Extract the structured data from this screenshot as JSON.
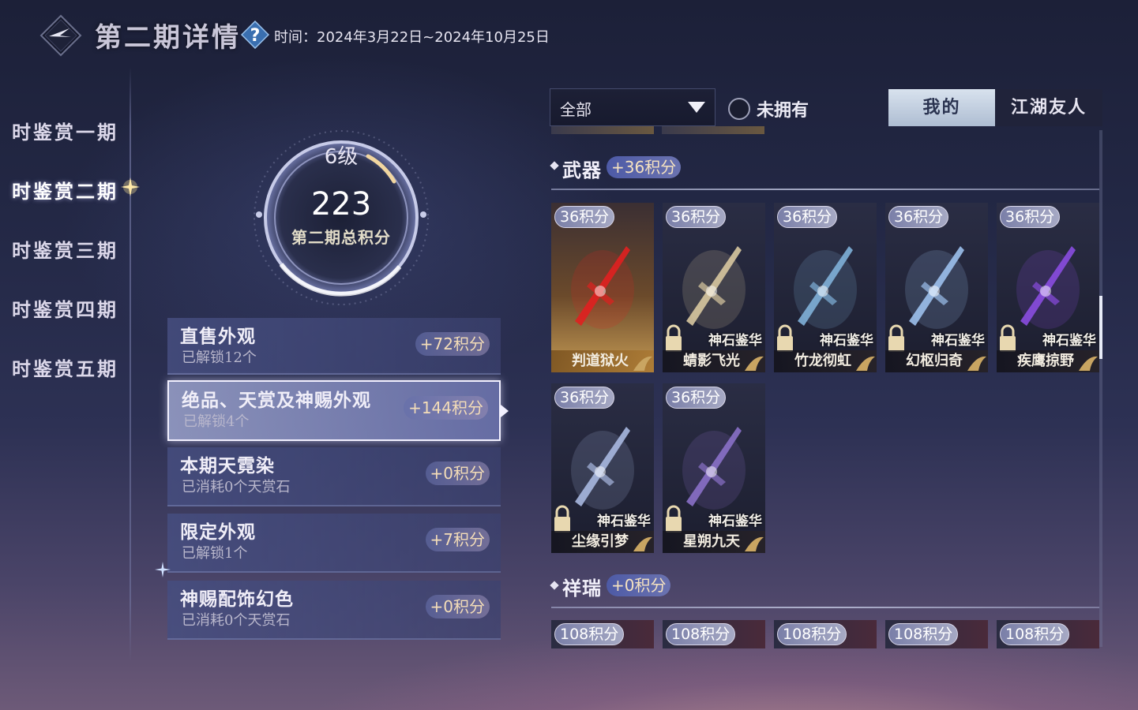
{
  "header": {
    "title": "第二期详情",
    "period_label": "时间：",
    "period_value": "2024年3月22日~2024年10月25日"
  },
  "nav": {
    "items": [
      {
        "label": "时鉴赏一期"
      },
      {
        "label": "时鉴赏二期"
      },
      {
        "label": "时鉴赏三期"
      },
      {
        "label": "时鉴赏四期"
      },
      {
        "label": "时鉴赏五期"
      }
    ],
    "active_index": 1
  },
  "summary": {
    "level": "6级",
    "total_score": "223",
    "score_label": "第二期总积分"
  },
  "categories": [
    {
      "title": "直售外观",
      "sub": "已解锁12个",
      "points": "+72积分"
    },
    {
      "title": "绝品、天赏及神赐外观",
      "sub": "已解锁4个",
      "points": "+144积分"
    },
    {
      "title": "本期天霓染",
      "sub": "已消耗0个天赏石",
      "points": "+0积分"
    },
    {
      "title": "限定外观",
      "sub": "已解锁1个",
      "points": "+7积分"
    },
    {
      "title": "神赐配饰幻色",
      "sub": "已消耗0个天赏石",
      "points": "+0积分"
    }
  ],
  "filters": {
    "select_value": "全部",
    "unowned_label": "未拥有",
    "tab_mine": "我的",
    "tab_friends": "江湖友人"
  },
  "sections": {
    "weapons": {
      "title": "武器",
      "points": "+36积分",
      "items": [
        {
          "points": "36积分",
          "name": "判道狱火",
          "tag": ""
        },
        {
          "points": "36积分",
          "name": "蜻影飞光",
          "tag": "神石鉴华"
        },
        {
          "points": "36积分",
          "name": "竹龙彻虹",
          "tag": "神石鉴华"
        },
        {
          "points": "36积分",
          "name": "幻枢归奇",
          "tag": "神石鉴华"
        },
        {
          "points": "36积分",
          "name": "疾鹰掠野",
          "tag": "神石鉴华"
        },
        {
          "points": "36积分",
          "name": "尘缘引梦",
          "tag": "神石鉴华"
        },
        {
          "points": "36积分",
          "name": "星朔九天",
          "tag": "神石鉴华"
        }
      ]
    },
    "auspicious": {
      "title": "祥瑞",
      "points": "+0积分",
      "items": [
        {
          "points": "108积分"
        },
        {
          "points": "108积分"
        },
        {
          "points": "108积分"
        },
        {
          "points": "108积分"
        },
        {
          "points": "108积分"
        }
      ]
    }
  },
  "colors": {
    "accent_gold": "#f4ddb8",
    "points_badge": "#5a63ad",
    "active_tab": "#c8d4e4"
  }
}
